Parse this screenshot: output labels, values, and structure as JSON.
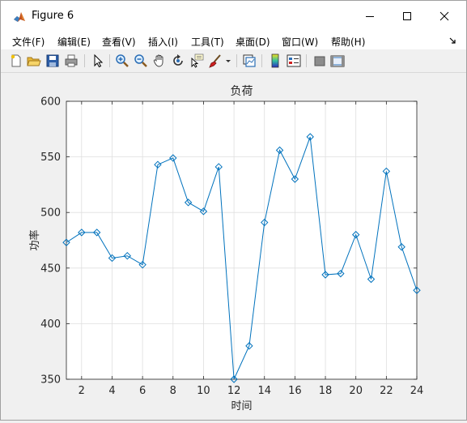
{
  "window": {
    "title": "Figure 6"
  },
  "menu": {
    "items": [
      "文件(F)",
      "编辑(E)",
      "查看(V)",
      "插入(I)",
      "工具(T)",
      "桌面(D)",
      "窗口(W)",
      "帮助(H)"
    ]
  },
  "toolbar": {
    "buttons": [
      "new-figure-icon",
      "open-file-icon",
      "save-icon",
      "print-icon",
      "select-arrow-icon",
      "zoom-in-icon",
      "zoom-out-icon",
      "pan-hand-icon",
      "rotate-3d-icon",
      "data-cursor-icon",
      "brush-icon",
      "brush-dropdown-icon",
      "link-plot-icon",
      "colorbar-icon",
      "legend-icon",
      "hide-plot-tools-icon",
      "show-plot-tools-icon"
    ]
  },
  "colors": {
    "line": "#0072bd",
    "grid": "#dfdfdf",
    "axes_bg": "#ffffff",
    "figure_bg": "#f0f0f0"
  },
  "chart_data": {
    "type": "line",
    "title": "负荷",
    "xlabel": "时间",
    "ylabel": "功率",
    "marker": "diamond",
    "xlim": [
      1,
      24
    ],
    "ylim": [
      350,
      600
    ],
    "xticks": [
      2,
      4,
      6,
      8,
      10,
      12,
      14,
      16,
      18,
      20,
      22,
      24
    ],
    "yticks": [
      350,
      400,
      450,
      500,
      550,
      600
    ],
    "grid": true,
    "x": [
      1,
      2,
      3,
      4,
      5,
      6,
      7,
      8,
      9,
      10,
      11,
      12,
      13,
      14,
      15,
      16,
      17,
      18,
      19,
      20,
      21,
      22,
      23,
      24
    ],
    "series": [
      {
        "values": [
          473,
          482,
          482,
          459,
          461,
          453,
          543,
          549,
          509,
          501,
          541,
          350,
          380,
          491,
          556,
          530,
          568,
          444,
          445,
          480,
          440,
          537,
          469,
          430
        ]
      }
    ]
  }
}
